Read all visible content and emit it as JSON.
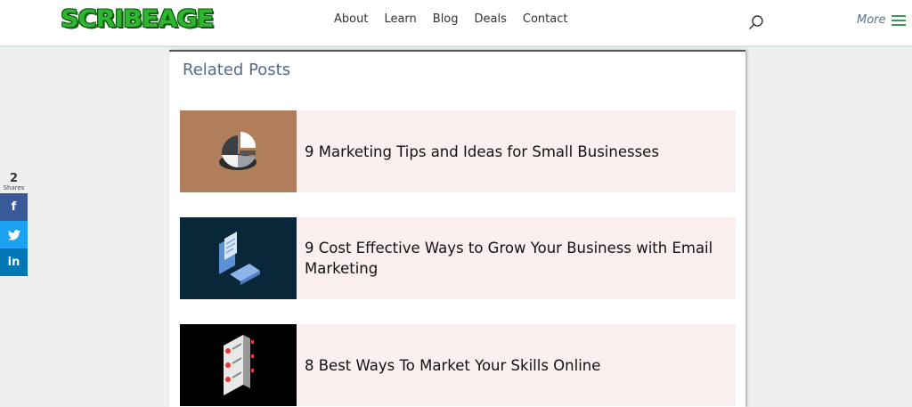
{
  "header": {
    "logo": "SCRIBEAGE",
    "nav": [
      "About",
      "Learn",
      "Blog",
      "Deals",
      "Contact"
    ],
    "search_icon": "search-icon",
    "more_label": "More",
    "menu_icon": "hamburger-menu-icon"
  },
  "related": {
    "title": "Related Posts",
    "posts": [
      {
        "title": "9 Marketing Tips and Ideas for Small Businesses",
        "thumb_bg": "#b07e5a"
      },
      {
        "title": "9 Cost Effective Ways to Grow Your Business with Email Marketing",
        "thumb_bg": "#08283a"
      },
      {
        "title": "8 Best Ways To Market Your Skills Online",
        "thumb_bg": "#000000"
      }
    ]
  },
  "share": {
    "count": "2",
    "label": "Shares",
    "buttons": [
      {
        "icon": "facebook-icon",
        "glyph": "f",
        "color": "#3b5998"
      },
      {
        "icon": "twitter-icon",
        "glyph": "t",
        "color": "#1da1f2"
      },
      {
        "icon": "linkedin-icon",
        "glyph": "in",
        "color": "#0077b5"
      }
    ]
  },
  "colors": {
    "logo_green": "#2fb52f",
    "accent_text": "#556a8a",
    "post_bg": "#fbefef"
  }
}
